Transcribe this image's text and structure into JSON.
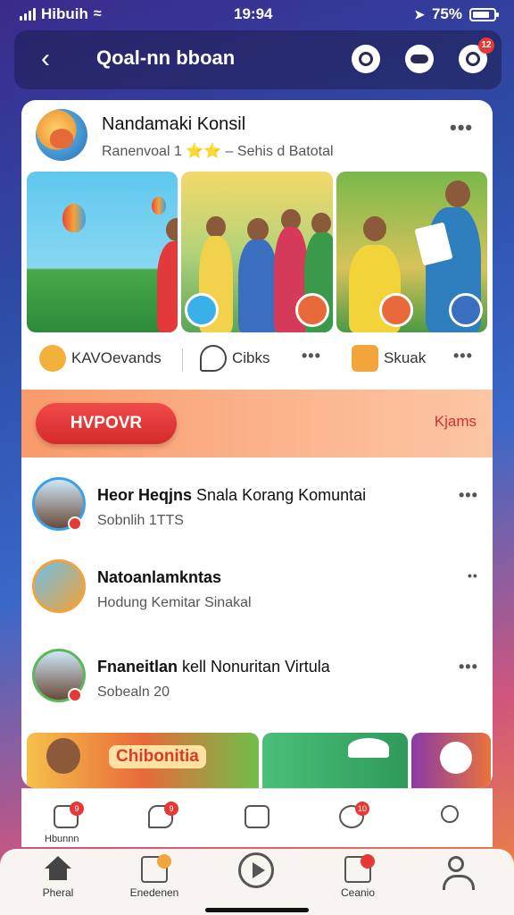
{
  "status": {
    "carrier": "Hibuih",
    "time": "19:94",
    "battery": "75%"
  },
  "header": {
    "title": "Qoal-nn bboan",
    "badge": "12"
  },
  "post": {
    "name": "Nandamaki Konsil",
    "subtitle": "Ranenvoal 1 ⭐⭐ – Sehis d Batotal",
    "more": "•••",
    "actions": [
      {
        "label": "KAVOevands"
      },
      {
        "label": "Cibks"
      },
      {
        "label": "Skuak"
      }
    ]
  },
  "promo": {
    "button": "HVPOVR",
    "link": "Kjams"
  },
  "rows": [
    {
      "name_bold": "Heor Heqjns",
      "name_rest": " Snala Korang Komuntai",
      "sub": "Sobnlih 1TTS"
    },
    {
      "name_bold": "Natoanlamkntas",
      "name_rest": "",
      "sub": "Hodung Kemitar  Sinakal"
    },
    {
      "name_bold": "Fnaneitlan",
      "name_rest": " kell Nonuritan Virtula",
      "sub": "Sobealn 20"
    }
  ],
  "strip": {
    "tag": "Chibonitia"
  },
  "inner_tabs": {
    "first_label": "Hbunnn",
    "badges": [
      "9",
      "9",
      "10"
    ]
  },
  "bottom_nav": [
    {
      "label": "Pheral"
    },
    {
      "label": "Enedenen"
    },
    {
      "label": ""
    },
    {
      "label": "Ceanio"
    },
    {
      "label": ""
    }
  ]
}
